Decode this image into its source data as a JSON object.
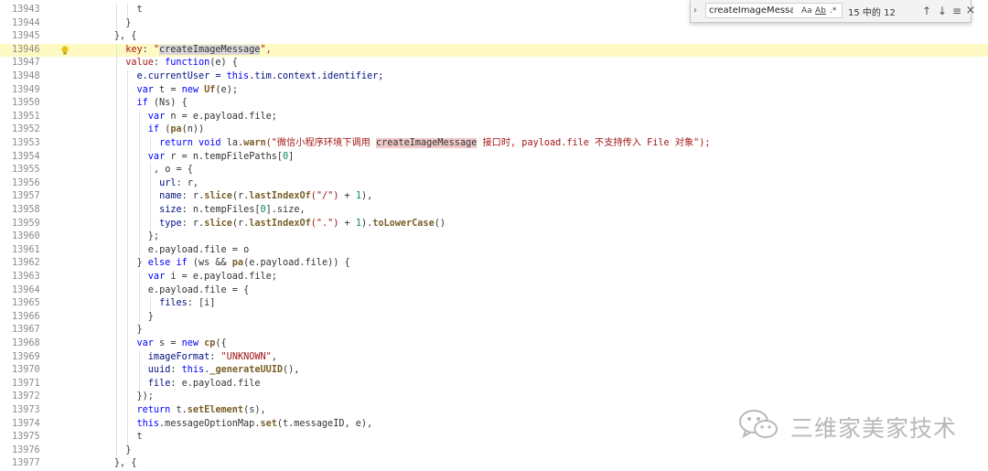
{
  "find_widget": {
    "query": "createImageMessage",
    "match_case_label": "Aa",
    "whole_word_label": "A̲b̲",
    "regex_label": ".*",
    "match_count": "15 中的 12"
  },
  "editor": {
    "line_numbers": [
      "13943",
      "13944",
      "13945",
      "13946",
      "13947",
      "13948",
      "13949",
      "13950",
      "13951",
      "13952",
      "13953",
      "13954",
      "13955",
      "13956",
      "13957",
      "13958",
      "13959",
      "13960",
      "13961",
      "13962",
      "13963",
      "13964",
      "13965",
      "13966",
      "13967",
      "13968",
      "13969",
      "13970",
      "13971",
      "13972",
      "13973",
      "13974",
      "13975",
      "13976",
      "13977"
    ],
    "lines": [
      {
        "indent": 10,
        "parts": [
          [
            "t",
            "p"
          ]
        ]
      },
      {
        "indent": 8,
        "parts": [
          [
            "}",
            "p"
          ]
        ]
      },
      {
        "indent": 6,
        "parts": [
          [
            "}, {",
            "p"
          ]
        ]
      },
      {
        "indent": 8,
        "parts": [
          [
            "key",
            "k"
          ],
          [
            ": ",
            "p"
          ],
          [
            "\"",
            "s"
          ],
          [
            "createImageMessage",
            "hl2"
          ],
          [
            "\",",
            "s"
          ]
        ]
      },
      {
        "indent": 8,
        "parts": [
          [
            "value",
            "k"
          ],
          [
            ": ",
            "p"
          ],
          [
            "function",
            "kw"
          ],
          [
            "(e) {",
            "p"
          ]
        ]
      },
      {
        "indent": 10,
        "parts": [
          [
            "e.currentUser = ",
            "prop"
          ],
          [
            "this",
            "kw"
          ],
          [
            ".tim.context.identifier;",
            "prop"
          ]
        ]
      },
      {
        "indent": 10,
        "parts": [
          [
            "var ",
            "kw"
          ],
          [
            "t = ",
            "p"
          ],
          [
            "new ",
            "kw"
          ],
          [
            "Uf",
            "fn"
          ],
          [
            "(e);",
            "p"
          ]
        ]
      },
      {
        "indent": 10,
        "parts": [
          [
            "if ",
            "kw"
          ],
          [
            "(Ns) {",
            "p"
          ]
        ]
      },
      {
        "indent": 12,
        "parts": [
          [
            "var ",
            "kw"
          ],
          [
            "n = e.payload.file;",
            "p"
          ]
        ]
      },
      {
        "indent": 12,
        "parts": [
          [
            "if ",
            "kw"
          ],
          [
            "(",
            "p"
          ],
          [
            "pa",
            "fn"
          ],
          [
            "(n))",
            "p"
          ]
        ]
      },
      {
        "indent": 14,
        "parts": [
          [
            "return ",
            "kw"
          ],
          [
            "void ",
            "kw"
          ],
          [
            "la.",
            "p"
          ],
          [
            "warn",
            "fn"
          ],
          [
            "(\"微信小程序环境下调用 ",
            "s"
          ],
          [
            "createImageMessage",
            "hl"
          ],
          [
            " 接口时, payload.file 不支持传入 File 对象\");",
            "s"
          ]
        ]
      },
      {
        "indent": 12,
        "parts": [
          [
            "var ",
            "kw"
          ],
          [
            "r = n.tempFilePaths[",
            "p"
          ],
          [
            "0",
            "n"
          ],
          [
            "]",
            "p"
          ]
        ]
      },
      {
        "indent": 13,
        "parts": [
          [
            ", o = {",
            "p"
          ]
        ]
      },
      {
        "indent": 14,
        "parts": [
          [
            "url",
            "prop"
          ],
          [
            ": r,",
            "p"
          ]
        ]
      },
      {
        "indent": 14,
        "parts": [
          [
            "name",
            "prop"
          ],
          [
            ": r.",
            "p"
          ],
          [
            "slice",
            "fn"
          ],
          [
            "(r.",
            "p"
          ],
          [
            "lastIndexOf",
            "fn"
          ],
          [
            "(\"/\")",
            "s"
          ],
          [
            " + ",
            "p"
          ],
          [
            "1",
            "n"
          ],
          [
            "),",
            "p"
          ]
        ]
      },
      {
        "indent": 14,
        "parts": [
          [
            "size",
            "prop"
          ],
          [
            ": n.tempFiles[",
            "p"
          ],
          [
            "0",
            "n"
          ],
          [
            "].size,",
            "p"
          ]
        ]
      },
      {
        "indent": 14,
        "parts": [
          [
            "type",
            "prop"
          ],
          [
            ": r.",
            "p"
          ],
          [
            "slice",
            "fn"
          ],
          [
            "(r.",
            "p"
          ],
          [
            "lastIndexOf",
            "fn"
          ],
          [
            "(\".\")",
            "s"
          ],
          [
            " + ",
            "p"
          ],
          [
            "1",
            "n"
          ],
          [
            ").",
            "p"
          ],
          [
            "toLowerCase",
            "fn"
          ],
          [
            "()",
            "p"
          ]
        ]
      },
      {
        "indent": 12,
        "parts": [
          [
            "};",
            "p"
          ]
        ]
      },
      {
        "indent": 12,
        "parts": [
          [
            "e.payload.file = o",
            "p"
          ]
        ]
      },
      {
        "indent": 10,
        "parts": [
          [
            "} ",
            "p"
          ],
          [
            "else if ",
            "kw"
          ],
          [
            "(ws && ",
            "p"
          ],
          [
            "pa",
            "fn"
          ],
          [
            "(e.payload.file)) {",
            "p"
          ]
        ]
      },
      {
        "indent": 12,
        "parts": [
          [
            "var ",
            "kw"
          ],
          [
            "i = e.payload.file;",
            "p"
          ]
        ]
      },
      {
        "indent": 12,
        "parts": [
          [
            "e.payload.file = {",
            "p"
          ]
        ]
      },
      {
        "indent": 14,
        "parts": [
          [
            "files",
            "prop"
          ],
          [
            ": [i]",
            "p"
          ]
        ]
      },
      {
        "indent": 12,
        "parts": [
          [
            "}",
            "p"
          ]
        ]
      },
      {
        "indent": 10,
        "parts": [
          [
            "}",
            "p"
          ]
        ]
      },
      {
        "indent": 10,
        "parts": [
          [
            "var ",
            "kw"
          ],
          [
            "s = ",
            "p"
          ],
          [
            "new ",
            "kw"
          ],
          [
            "cp",
            "fn"
          ],
          [
            "({",
            "p"
          ]
        ]
      },
      {
        "indent": 12,
        "parts": [
          [
            "imageFormat",
            "prop"
          ],
          [
            ": ",
            "p"
          ],
          [
            "\"UNKNOWN\"",
            "s"
          ],
          [
            ",",
            "p"
          ]
        ]
      },
      {
        "indent": 12,
        "parts": [
          [
            "uuid",
            "prop"
          ],
          [
            ": ",
            "p"
          ],
          [
            "this",
            "kw"
          ],
          [
            ".",
            "p"
          ],
          [
            "_generateUUID",
            "fn"
          ],
          [
            "(),",
            "p"
          ]
        ]
      },
      {
        "indent": 12,
        "parts": [
          [
            "file",
            "prop"
          ],
          [
            ": e.payload.file",
            "p"
          ]
        ]
      },
      {
        "indent": 10,
        "parts": [
          [
            "});",
            "p"
          ]
        ]
      },
      {
        "indent": 10,
        "parts": [
          [
            "return ",
            "kw"
          ],
          [
            "t.",
            "p"
          ],
          [
            "setElement",
            "fn"
          ],
          [
            "(s),",
            "p"
          ]
        ]
      },
      {
        "indent": 10,
        "parts": [
          [
            "this",
            "kw"
          ],
          [
            ".messageOptionMap.",
            "p"
          ],
          [
            "set",
            "fn"
          ],
          [
            "(t.messageID, e),",
            "p"
          ]
        ]
      },
      {
        "indent": 10,
        "parts": [
          [
            "t",
            "p"
          ]
        ]
      },
      {
        "indent": 8,
        "parts": [
          [
            "}",
            "p"
          ]
        ]
      },
      {
        "indent": 6,
        "parts": [
          [
            "}, {",
            "p"
          ]
        ]
      }
    ],
    "current_line_index": 3
  },
  "watermark": {
    "text": "三维家美家技术"
  },
  "colors": {
    "current_line": "#fff9c4",
    "search_highlight": "#f1c9c9"
  }
}
